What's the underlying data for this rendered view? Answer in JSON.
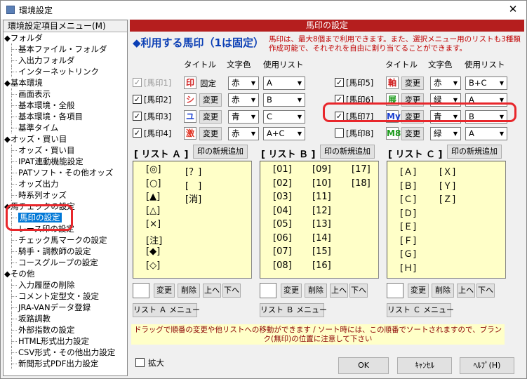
{
  "window": {
    "title": "環境設定",
    "close": "✕"
  },
  "tree": {
    "header": "環境設定項目メニュー(M)",
    "nodes": [
      {
        "type": "cat",
        "label": "◆フォルダ"
      },
      {
        "type": "leaf",
        "label": "基本ファイル・フォルダ"
      },
      {
        "type": "leaf",
        "label": "入出力フォルダ"
      },
      {
        "type": "leaf",
        "label": "インターネットリンク"
      },
      {
        "type": "cat",
        "label": "◆基本環境"
      },
      {
        "type": "leaf",
        "label": "画面表示"
      },
      {
        "type": "leaf",
        "label": "基本環境・全般"
      },
      {
        "type": "leaf",
        "label": "基本環境・各項目"
      },
      {
        "type": "leaf",
        "label": "基準タイム"
      },
      {
        "type": "cat",
        "label": "◆オッズ・買い目"
      },
      {
        "type": "leaf",
        "label": "オッズ・買い目"
      },
      {
        "type": "leaf",
        "label": "IPAT連動機能設定"
      },
      {
        "type": "leaf",
        "label": "PATソフト・その他オッズ"
      },
      {
        "type": "leaf",
        "label": "オッズ出力"
      },
      {
        "type": "leaf",
        "label": "時系列オッズ"
      },
      {
        "type": "cat",
        "label": "◆馬チェックの設定"
      },
      {
        "type": "leaf",
        "label": "馬印の設定",
        "selected": true
      },
      {
        "type": "leaf",
        "label": "レース印の設定"
      },
      {
        "type": "leaf",
        "label": "チェック馬マークの設定"
      },
      {
        "type": "leaf",
        "label": "騎手・調教師の設定"
      },
      {
        "type": "leaf",
        "label": "コースグループの設定"
      },
      {
        "type": "cat",
        "label": "◆その他"
      },
      {
        "type": "leaf",
        "label": "入力履歴の削除"
      },
      {
        "type": "leaf",
        "label": "コメント定型文・設定"
      },
      {
        "type": "leaf",
        "label": "JRA-VANデータ登録"
      },
      {
        "type": "leaf",
        "label": "坂路調教"
      },
      {
        "type": "leaf",
        "label": "外部指数の設定"
      },
      {
        "type": "leaf",
        "label": "HTML形式出力設定"
      },
      {
        "type": "leaf",
        "label": "CSV形式・その他出力設定"
      },
      {
        "type": "leaf",
        "label": "新聞形式PDF出力設定"
      }
    ]
  },
  "panel": {
    "header": "馬印の設定",
    "heading": "◆利用する馬印（1は固定）",
    "note": "馬印は、最大8個まで利用できます。また、選択メニュー用のリストも3種類作成可能で、それぞれを自由に割り当てることができます。",
    "col_title": "タイトル",
    "col_color": "文字色",
    "col_list": "使用リスト",
    "change_label": "変更",
    "fixed_label": "固定",
    "marks": [
      {
        "label": "[馬印1]",
        "checked": true,
        "disabled": true,
        "symbol": "印",
        "sym_color": "#d02020",
        "fixed": true,
        "color": "赤",
        "list": "A"
      },
      {
        "label": "[馬印2]",
        "checked": true,
        "symbol": "シ",
        "sym_color": "#e04040",
        "color": "赤",
        "list": "B"
      },
      {
        "label": "[馬印3]",
        "checked": true,
        "symbol": "ユ",
        "sym_color": "#1a3fd0",
        "color": "青",
        "list": "C"
      },
      {
        "label": "[馬印4]",
        "checked": true,
        "symbol": "激",
        "sym_color": "#e03020",
        "color": "赤",
        "list": "A+C"
      },
      {
        "label": "[馬印5]",
        "checked": true,
        "symbol": "軸",
        "sym_color": "#d02020",
        "color": "赤",
        "list": "B+C"
      },
      {
        "label": "[馬印6]",
        "checked": true,
        "symbol": "展",
        "sym_color": "#1a9a1a",
        "color": "緑",
        "list": "A"
      },
      {
        "label": "[馬印7]",
        "checked": true,
        "symbol": "My",
        "sym_color": "#1a3fd0",
        "color": "青",
        "list": "B"
      },
      {
        "label": "[馬印8]",
        "checked": false,
        "symbol": "M8",
        "sym_color": "#1a9a1a",
        "color": "緑",
        "list": "A"
      }
    ]
  },
  "lists": [
    {
      "title": "[ リスト Ａ ]",
      "add": "印の新規追加",
      "menu": "リスト Ａ メニュー",
      "cols": [
        [
          "[◎]",
          "[○]",
          "[▲]",
          "[△]",
          "[×]",
          "[注]",
          "[◆]",
          "[◇]"
        ],
        [
          "[？]",
          "[　]",
          "[消]"
        ]
      ]
    },
    {
      "title": "[ リスト Ｂ ]",
      "add": "印の新規追加",
      "menu": "リスト Ｂ メニュー",
      "cols": [
        [
          "[01]",
          "[02]",
          "[03]",
          "[04]",
          "[05]",
          "[06]",
          "[07]",
          "[08]"
        ],
        [
          "[09]",
          "[10]",
          "[11]",
          "[12]",
          "[13]",
          "[14]",
          "[15]",
          "[16]"
        ],
        [
          "[17]",
          "[18]"
        ]
      ]
    },
    {
      "title": "[ リスト Ｃ ]",
      "add": "印の新規追加",
      "menu": "リスト Ｃ メニュー",
      "cols": [
        [
          "[Ａ]",
          "[Ｂ]",
          "[Ｃ]",
          "[Ｄ]",
          "[Ｅ]",
          "[Ｆ]",
          "[Ｇ]",
          "[Ｈ]"
        ],
        [
          "[Ｘ]",
          "[Ｙ]",
          "[Ｚ]"
        ]
      ]
    }
  ],
  "list_buttons": {
    "change": "変更",
    "delete": "削除",
    "up": "上へ",
    "down": "下へ"
  },
  "hint": "ドラッグで順番の変更や他リストへの移動ができます / ソート時には、この順番でソートされますので、ブランク(無印)の位置に注意して下さい",
  "footer": {
    "enlarge": "拡大",
    "ok": "OK",
    "cancel": "ｷｬﾝｾﾙ",
    "help": "ﾍﾙﾌﾟ(H)"
  },
  "colors": {
    "header_bg": "#b51e1e",
    "heading": "#0b3fb5",
    "list_bg": "#ffffc8",
    "highlight": "#e8262b",
    "selection": "#0078d7"
  }
}
